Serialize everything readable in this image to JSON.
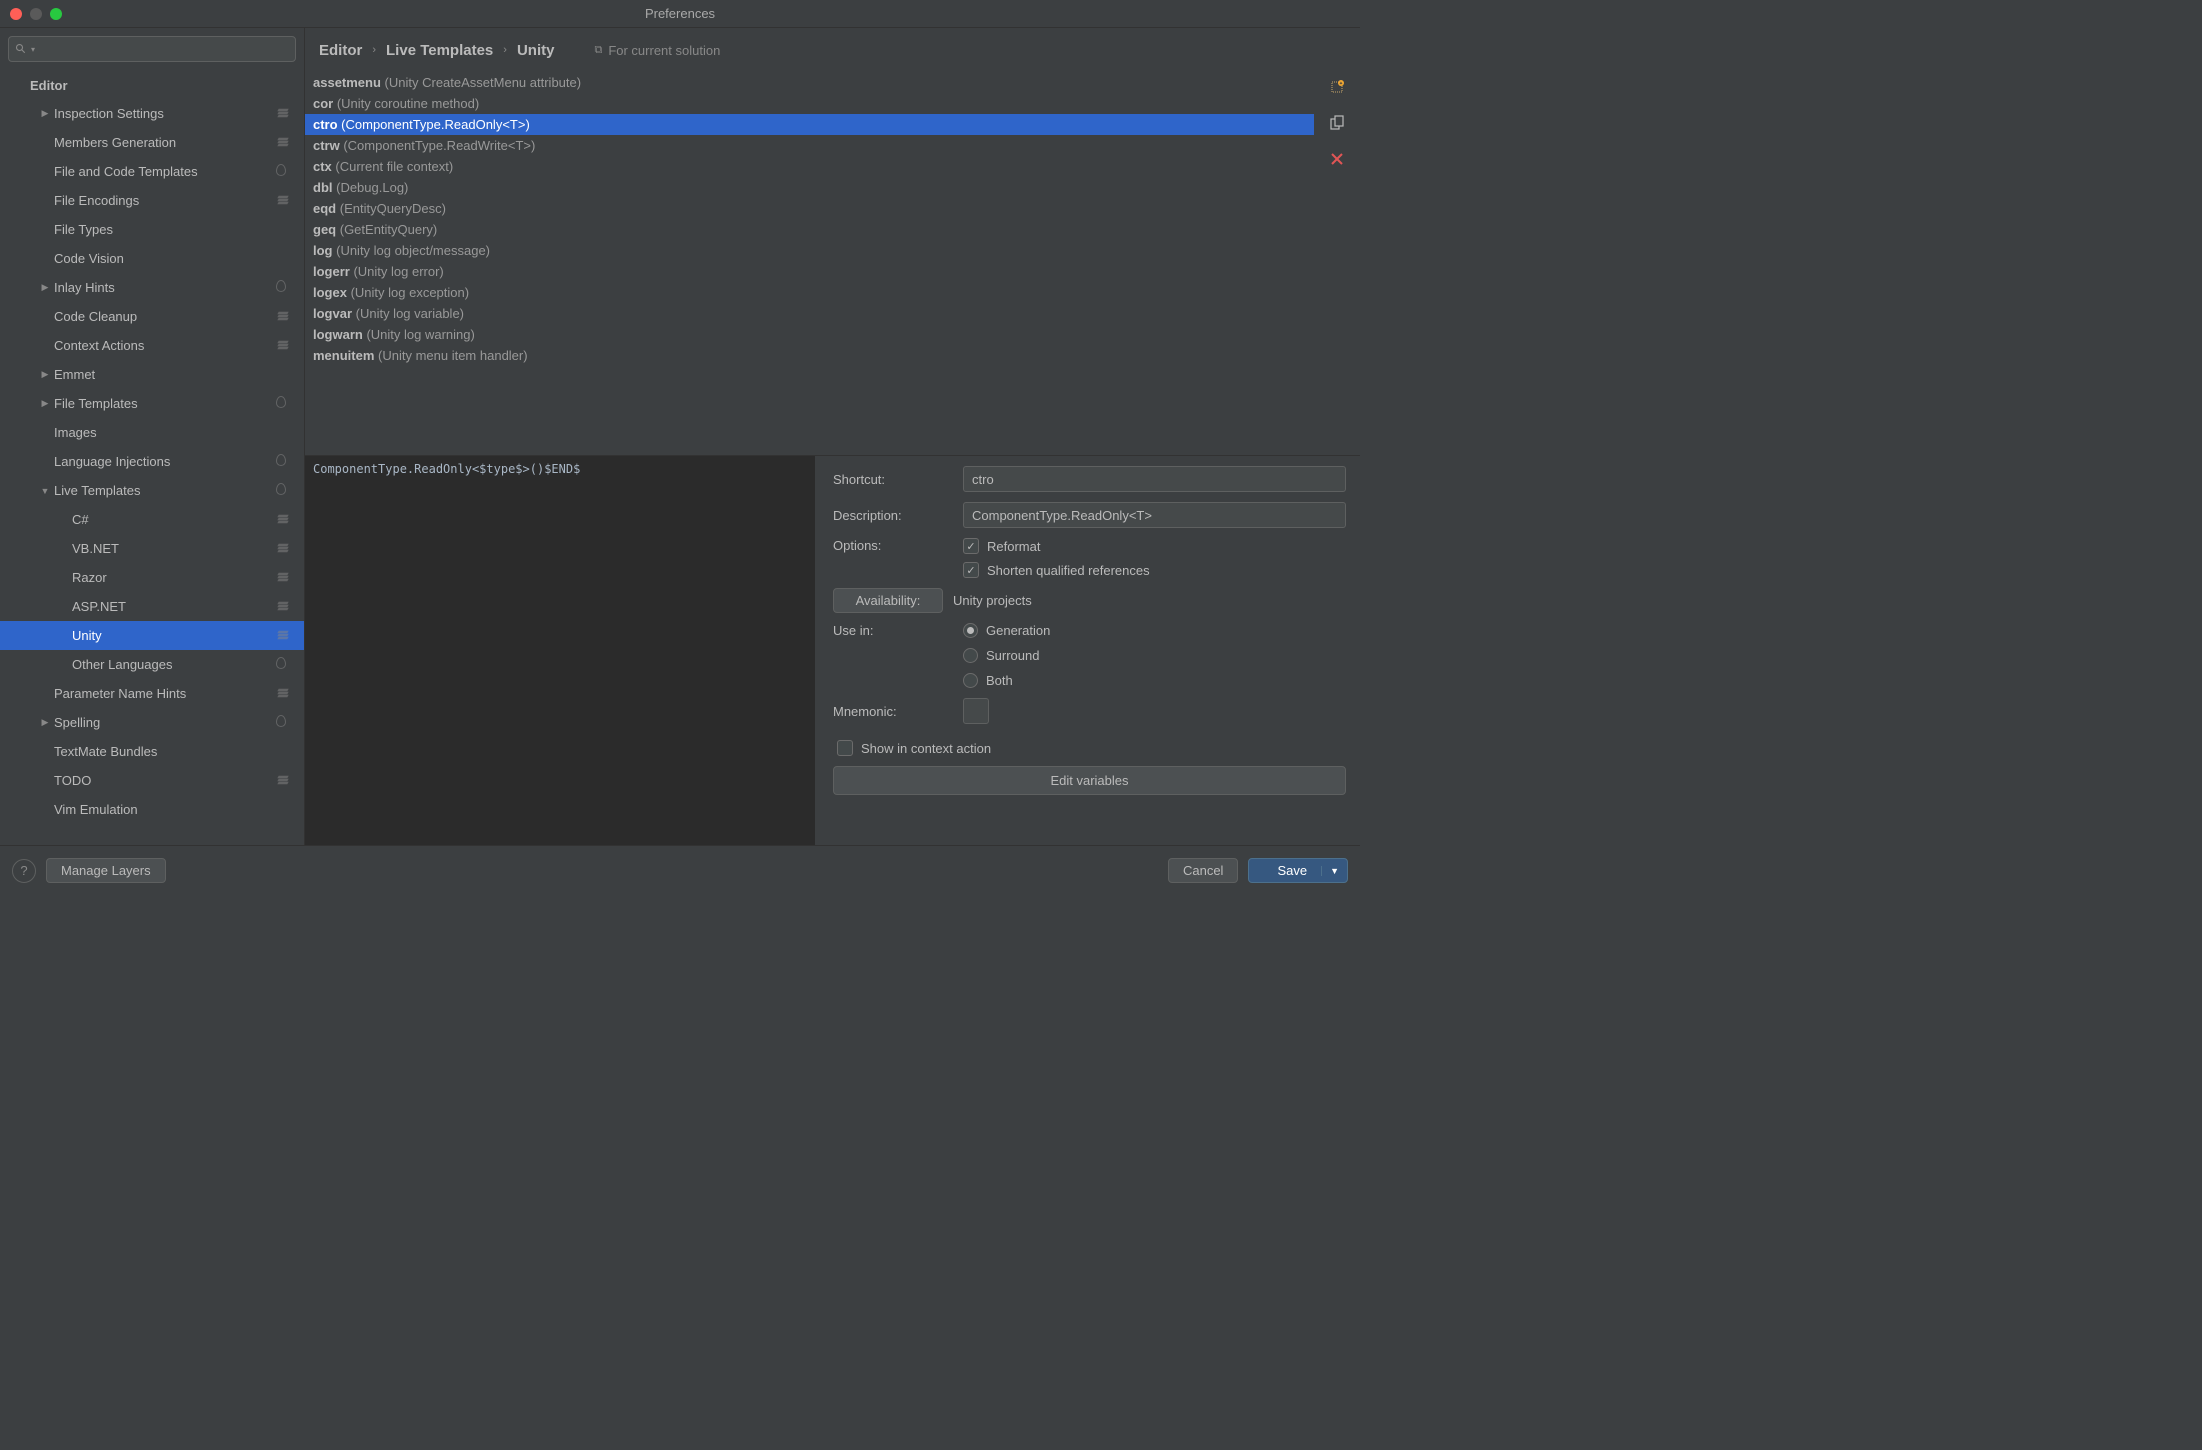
{
  "window": {
    "title": "Preferences"
  },
  "search": {
    "placeholder": ""
  },
  "sidebar": {
    "header": "Editor",
    "items": [
      {
        "label": "Inspection Settings",
        "indent": 1,
        "arrow": "▶",
        "badge": "stack"
      },
      {
        "label": "Members Generation",
        "indent": 1,
        "arrow": "",
        "badge": "stack"
      },
      {
        "label": "File and Code Templates",
        "indent": 1,
        "arrow": "",
        "badge": "drop"
      },
      {
        "label": "File Encodings",
        "indent": 1,
        "arrow": "",
        "badge": "stack"
      },
      {
        "label": "File Types",
        "indent": 1,
        "arrow": "",
        "badge": ""
      },
      {
        "label": "Code Vision",
        "indent": 1,
        "arrow": "",
        "badge": ""
      },
      {
        "label": "Inlay Hints",
        "indent": 1,
        "arrow": "▶",
        "badge": "drop"
      },
      {
        "label": "Code Cleanup",
        "indent": 1,
        "arrow": "",
        "badge": "stack"
      },
      {
        "label": "Context Actions",
        "indent": 1,
        "arrow": "",
        "badge": "stack"
      },
      {
        "label": "Emmet",
        "indent": 1,
        "arrow": "▶",
        "badge": ""
      },
      {
        "label": "File Templates",
        "indent": 1,
        "arrow": "▶",
        "badge": "drop"
      },
      {
        "label": "Images",
        "indent": 1,
        "arrow": "",
        "badge": ""
      },
      {
        "label": "Language Injections",
        "indent": 1,
        "arrow": "",
        "badge": "drop"
      },
      {
        "label": "Live Templates",
        "indent": 1,
        "arrow": "▼",
        "badge": "drop"
      },
      {
        "label": "C#",
        "indent": 2,
        "arrow": "",
        "badge": "stack"
      },
      {
        "label": "VB.NET",
        "indent": 2,
        "arrow": "",
        "badge": "stack"
      },
      {
        "label": "Razor",
        "indent": 2,
        "arrow": "",
        "badge": "stack"
      },
      {
        "label": "ASP.NET",
        "indent": 2,
        "arrow": "",
        "badge": "stack"
      },
      {
        "label": "Unity",
        "indent": 2,
        "arrow": "",
        "badge": "stack",
        "selected": true
      },
      {
        "label": "Other Languages",
        "indent": 2,
        "arrow": "",
        "badge": "drop"
      },
      {
        "label": "Parameter Name Hints",
        "indent": 1,
        "arrow": "",
        "badge": "stack"
      },
      {
        "label": "Spelling",
        "indent": 1,
        "arrow": "▶",
        "badge": "drop"
      },
      {
        "label": "TextMate Bundles",
        "indent": 1,
        "arrow": "",
        "badge": ""
      },
      {
        "label": "TODO",
        "indent": 1,
        "arrow": "",
        "badge": "stack"
      },
      {
        "label": "Vim Emulation",
        "indent": 1,
        "arrow": "",
        "badge": ""
      }
    ]
  },
  "breadcrumb": {
    "a": "Editor",
    "b": "Live Templates",
    "c": "Unity"
  },
  "solution_link": "For current solution",
  "templates": [
    {
      "abbr": "assetmenu",
      "desc": "(Unity CreateAssetMenu attribute)"
    },
    {
      "abbr": "cor",
      "desc": "(Unity coroutine method)"
    },
    {
      "abbr": "ctro",
      "desc": "(ComponentType.ReadOnly<T>)",
      "selected": true
    },
    {
      "abbr": "ctrw",
      "desc": "(ComponentType.ReadWrite<T>)"
    },
    {
      "abbr": "ctx",
      "desc": "(Current file context)"
    },
    {
      "abbr": "dbl",
      "desc": "(Debug.Log)"
    },
    {
      "abbr": "eqd",
      "desc": "(EntityQueryDesc)"
    },
    {
      "abbr": "geq",
      "desc": "(GetEntityQuery)"
    },
    {
      "abbr": "log",
      "desc": "(Unity log object/message)"
    },
    {
      "abbr": "logerr",
      "desc": "(Unity log error)"
    },
    {
      "abbr": "logex",
      "desc": "(Unity log exception)"
    },
    {
      "abbr": "logvar",
      "desc": "(Unity log variable)"
    },
    {
      "abbr": "logwarn",
      "desc": "(Unity log warning)"
    },
    {
      "abbr": "menuitem",
      "desc": "(Unity menu item handler)"
    }
  ],
  "code": "ComponentType.ReadOnly<$type$>()$END$",
  "details": {
    "shortcut_label": "Shortcut:",
    "shortcut_value": "ctro",
    "description_label": "Description:",
    "description_value": "ComponentType.ReadOnly<T>",
    "options_label": "Options:",
    "opt_reformat": "Reformat",
    "opt_shorten": "Shorten qualified references",
    "availability_btn": "Availability:",
    "availability_value": "Unity projects",
    "usein_label": "Use in:",
    "radio_generation": "Generation",
    "radio_surround": "Surround",
    "radio_both": "Both",
    "mnemonic_label": "Mnemonic:",
    "show_context": "Show in context action",
    "edit_vars": "Edit variables"
  },
  "footer": {
    "manage_layers": "Manage Layers",
    "cancel": "Cancel",
    "save": "Save"
  }
}
